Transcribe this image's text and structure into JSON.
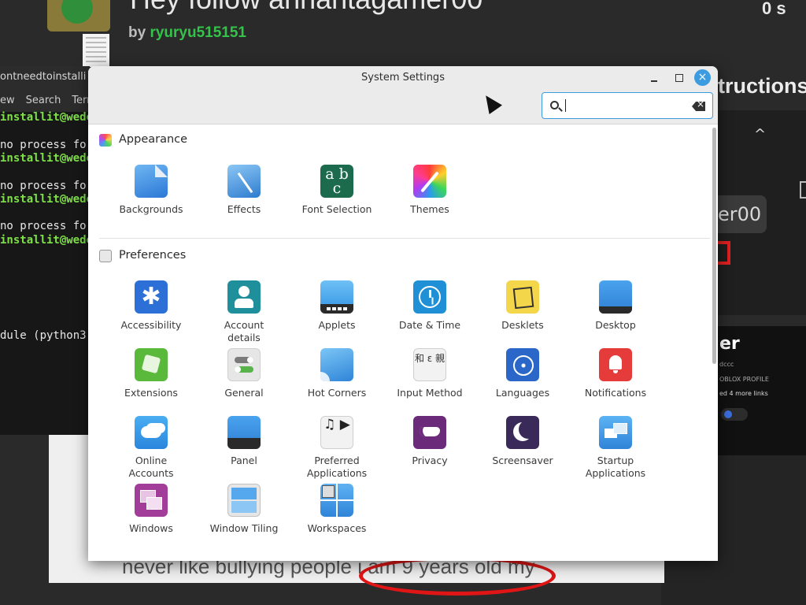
{
  "background_page": {
    "title": "Hey follow anhantagamer00",
    "by_prefix": "by",
    "author": "ryuryu515151",
    "top_right": "0 s",
    "side_heading": "tructions",
    "username_fragment": "er00",
    "card_title": "er",
    "card_line1": "dccc",
    "card_line2": "OBLOX PROFILE",
    "card_line3": "ed 4 more links",
    "caption": "never like bullying people i am 9 years old my"
  },
  "terminal": {
    "title": "ontneedtoinstalli",
    "menu": [
      "ew",
      "Search",
      "Terr"
    ],
    "lines": [
      {
        "text": "installit@wedo",
        "kind": "green"
      },
      {
        "text": "",
        "kind": "white"
      },
      {
        "text": " no process fo",
        "kind": "white"
      },
      {
        "text": "installit@wedo",
        "kind": "green"
      },
      {
        "text": "",
        "kind": "white"
      },
      {
        "text": " no process fo",
        "kind": "white"
      },
      {
        "text": "installit@wedo",
        "kind": "green"
      },
      {
        "text": "",
        "kind": "white"
      },
      {
        "text": " no process fo",
        "kind": "white"
      },
      {
        "text": "installit@wedo",
        "kind": "green"
      },
      {
        "text": "",
        "kind": "white"
      },
      {
        "text": "",
        "kind": "white"
      },
      {
        "text": "",
        "kind": "white"
      },
      {
        "text": "",
        "kind": "white"
      },
      {
        "text": "",
        "kind": "white"
      },
      {
        "text": "",
        "kind": "white"
      },
      {
        "text": "dule (python3-",
        "kind": "white"
      }
    ]
  },
  "window": {
    "title": "System Settings",
    "search": {
      "value": "",
      "placeholder": ""
    },
    "accent_color": "#3d9be0"
  },
  "sections": {
    "appearance": {
      "label": "Appearance",
      "items": [
        {
          "label": "Backgrounds",
          "icon": "backgrounds-icon"
        },
        {
          "label": "Effects",
          "icon": "effects-icon"
        },
        {
          "label": "Font Selection",
          "icon": "font-selection-icon"
        },
        {
          "label": "Themes",
          "icon": "themes-icon"
        }
      ]
    },
    "preferences": {
      "label": "Preferences",
      "items": [
        {
          "label": "Accessibility",
          "icon": "accessibility-icon"
        },
        {
          "label": "Account details",
          "icon": "account-details-icon"
        },
        {
          "label": "Applets",
          "icon": "applets-icon"
        },
        {
          "label": "Date & Time",
          "icon": "date-time-icon"
        },
        {
          "label": "Desklets",
          "icon": "desklets-icon"
        },
        {
          "label": "Desktop",
          "icon": "desktop-icon"
        },
        {
          "label": "Extensions",
          "icon": "extensions-icon"
        },
        {
          "label": "General",
          "icon": "general-icon"
        },
        {
          "label": "Hot Corners",
          "icon": "hot-corners-icon"
        },
        {
          "label": "Input Method",
          "icon": "input-method-icon"
        },
        {
          "label": "Languages",
          "icon": "languages-icon"
        },
        {
          "label": "Notifications",
          "icon": "notifications-icon"
        },
        {
          "label": "Online Accounts",
          "icon": "online-accounts-icon"
        },
        {
          "label": "Panel",
          "icon": "panel-icon"
        },
        {
          "label": "Preferred Applications",
          "icon": "preferred-applications-icon"
        },
        {
          "label": "Privacy",
          "icon": "privacy-icon"
        },
        {
          "label": "Screensaver",
          "icon": "screensaver-icon"
        },
        {
          "label": "Startup Applications",
          "icon": "startup-applications-icon"
        },
        {
          "label": "Windows",
          "icon": "windows-icon"
        },
        {
          "label": "Window Tiling",
          "icon": "window-tiling-icon"
        },
        {
          "label": "Workspaces",
          "icon": "workspaces-icon"
        }
      ]
    }
  },
  "icon_glyphs": {
    "font_selection": "a b c",
    "accessibility": "✱",
    "input_method": "和 ε 親",
    "preferred_applications": "♫ ▶"
  }
}
